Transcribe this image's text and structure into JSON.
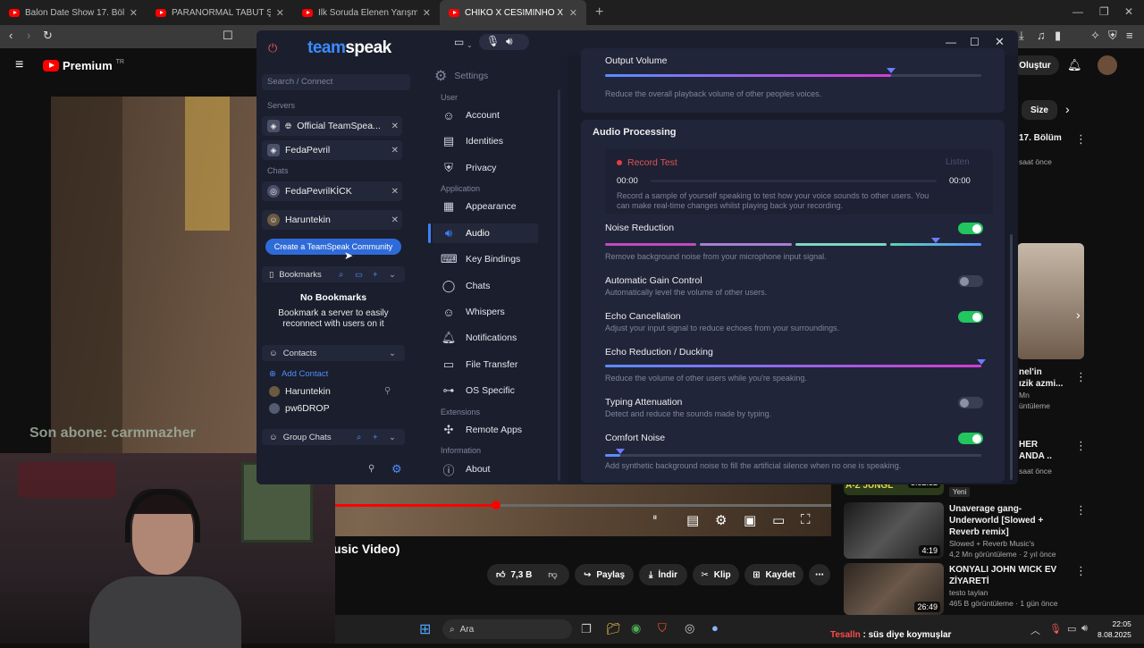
{
  "browser": {
    "tabs": [
      {
        "title": "Balon Date Show 17. Bölüm - YouTube"
      },
      {
        "title": "PARANORMAL TABUT ŞAKASI! - ( PA"
      },
      {
        "title": "İlk Soruda Elenen Yarışmacılar | Kim M"
      },
      {
        "title": "CHİKO X CESİMİNHO X ELMUSTAFA"
      }
    ],
    "new_tab": "+"
  },
  "youtube": {
    "brand": "Premium",
    "region": "TR",
    "create_label": "Oluştur",
    "chip": "Size",
    "subtitle": "Son abone: carmmazher",
    "video_title": "usic Video)",
    "actions": {
      "likes": "7,3 B",
      "share": "Paylaş",
      "download": "İndir",
      "clip": "Klip",
      "save": "Kaydet"
    },
    "side": [
      {
        "title": "17. Bölüm",
        "meta": "saat önce"
      },
      {
        "title": "nel'in\nızik azmi...",
        "meta": "Mn\nüntüleme"
      },
      {
        "title": "HER\nANDA ..",
        "meta": "saat önce"
      },
      {
        "title": "Unaverage gang-Underworld [Slowed + Reverb remix]",
        "meta1": "Slowed + Reverb Music's",
        "meta2": "4,2 Mn görüntüleme · 2 yıl önce",
        "duration": "4:19"
      },
      {
        "title": "KONYALI JOHN WICK EV ZİYARETİ",
        "meta1": "testo taylan",
        "meta2": "465 B görüntüleme · 1 gün önce",
        "duration": "26:49"
      }
    ],
    "badge_new": "Yeni",
    "thumb_label": "A-Z JUNGL",
    "thumb_time": "3:52:32"
  },
  "taskbar": {
    "search": "Ara",
    "chat_name": "Tesalln",
    "chat_text": ": süs diye koymuşlar",
    "time": "22:05",
    "date": "8.08.2025"
  },
  "teamspeak": {
    "logo_a": "team",
    "logo_b": "speak",
    "search_placeholder": "Search / Connect",
    "servers_label": "Servers",
    "servers": [
      {
        "name": "Official TeamSpea..."
      },
      {
        "name": "FedaPevril"
      }
    ],
    "chats_label": "Chats",
    "chats": [
      {
        "name": "FedaPevrilKİCK"
      },
      {
        "name": "Haruntekin"
      }
    ],
    "create_community": "Create a TeamSpeak Community",
    "bookmarks_label": "Bookmarks",
    "no_bookmarks": "No Bookmarks",
    "no_bookmarks_sub": "Bookmark a server to easily reconnect with users on it",
    "contacts_label": "Contacts",
    "add_contact": "Add Contact",
    "contacts": [
      {
        "name": "Haruntekin"
      },
      {
        "name": "pw6DROP"
      }
    ],
    "group_chats_label": "Group Chats",
    "settings_title": "Settings",
    "nav": {
      "user": "User",
      "account": "Account",
      "identities": "Identities",
      "privacy": "Privacy",
      "application": "Application",
      "appearance": "Appearance",
      "audio": "Audio",
      "key_bindings": "Key Bindings",
      "chats": "Chats",
      "whispers": "Whispers",
      "notifications": "Notifications",
      "file_transfer": "File Transfer",
      "os_specific": "OS Specific",
      "extensions": "Extensions",
      "remote_apps": "Remote Apps",
      "information": "Information",
      "about": "About"
    },
    "audio": {
      "output_volume": {
        "title": "Output Volume",
        "desc": "Reduce the overall playback volume of other peoples voices.",
        "value": 0.76
      },
      "processing_title": "Audio Processing",
      "record_test": "Record Test",
      "listen": "Listen",
      "time_start": "00:00",
      "time_end": "00:00",
      "record_desc": "Record a sample of yourself speaking to test how your voice sounds to other users. You can make real-time changes whilst playing back your recording.",
      "noise_reduction": {
        "title": "Noise Reduction",
        "desc": "Remove background noise from your microphone input signal.",
        "on": true,
        "value": 0.88
      },
      "agc": {
        "title": "Automatic Gain Control",
        "desc": "Automatically level the volume of other users.",
        "on": false
      },
      "echo_cancel": {
        "title": "Echo Cancellation",
        "desc": "Adjust your input signal to reduce echoes from your surroundings.",
        "on": true
      },
      "echo_reduction": {
        "title": "Echo Reduction / Ducking",
        "desc": "Reduce the volume of other users while you're speaking.",
        "value": 1.0
      },
      "typing": {
        "title": "Typing Attenuation",
        "desc": "Detect and reduce the sounds made by typing.",
        "on": false
      },
      "comfort": {
        "title": "Comfort Noise",
        "desc": "Add synthetic background noise to fill the artificial silence when no one is speaking.",
        "on": true,
        "value": 0.04
      }
    }
  }
}
